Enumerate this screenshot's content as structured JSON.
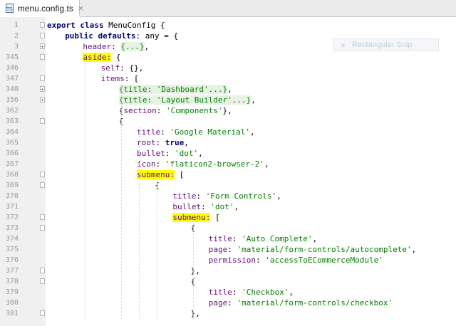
{
  "tab": {
    "file_name": "menu.config.ts",
    "icon": "typescript-file-icon",
    "close": "×",
    "icon_text": "TS"
  },
  "overlay": {
    "label": "Rectangular Snip"
  },
  "lines": [
    {
      "n": "1",
      "fold": "minus",
      "indent": 0,
      "parts": [
        {
          "t": "export class ",
          "c": "kw"
        },
        {
          "t": "MenuConfig {",
          "c": "plain"
        }
      ]
    },
    {
      "n": "2",
      "fold": "minus",
      "indent": 2,
      "parts": [
        {
          "t": "public ",
          "c": "kw"
        },
        {
          "t": "defaults",
          "c": "kw"
        },
        {
          "t": ": any = {",
          "c": "plain"
        }
      ]
    },
    {
      "n": "3",
      "fold": "plus",
      "indent": 4,
      "parts": [
        {
          "t": "header",
          "c": "prop"
        },
        {
          "t": ": ",
          "c": "plain"
        },
        {
          "t": "{...}",
          "c": "folded"
        },
        {
          "t": ",",
          "c": "plain"
        }
      ]
    },
    {
      "n": "345",
      "fold": "minus",
      "indent": 4,
      "parts": [
        {
          "t": "aside:",
          "c": "prop hl"
        },
        {
          "t": " {",
          "c": "plain"
        }
      ]
    },
    {
      "n": "346",
      "fold": "",
      "indent": 6,
      "parts": [
        {
          "t": "self",
          "c": "prop"
        },
        {
          "t": ": {},",
          "c": "plain"
        }
      ]
    },
    {
      "n": "347",
      "fold": "minus",
      "indent": 6,
      "parts": [
        {
          "t": "items",
          "c": "prop"
        },
        {
          "t": ": [",
          "c": "plain"
        }
      ]
    },
    {
      "n": "348",
      "fold": "plus",
      "indent": 8,
      "parts": [
        {
          "t": "{title: 'Dashboard'...}",
          "c": "folded"
        },
        {
          "t": ",",
          "c": "plain"
        }
      ]
    },
    {
      "n": "356",
      "fold": "plus",
      "indent": 8,
      "parts": [
        {
          "t": "{title: 'Layout Builder'...}",
          "c": "folded"
        },
        {
          "t": ",",
          "c": "plain"
        }
      ]
    },
    {
      "n": "362",
      "fold": "",
      "indent": 8,
      "parts": [
        {
          "t": "{",
          "c": "plain"
        },
        {
          "t": "section",
          "c": "prop"
        },
        {
          "t": ": ",
          "c": "plain"
        },
        {
          "t": "'Components'",
          "c": "str"
        },
        {
          "t": "},",
          "c": "plain"
        }
      ]
    },
    {
      "n": "363",
      "fold": "minus",
      "indent": 8,
      "parts": [
        {
          "t": "{",
          "c": "plain"
        }
      ]
    },
    {
      "n": "364",
      "fold": "",
      "indent": 10,
      "parts": [
        {
          "t": "title",
          "c": "prop"
        },
        {
          "t": ": ",
          "c": "plain"
        },
        {
          "t": "'Google Material'",
          "c": "str"
        },
        {
          "t": ",",
          "c": "plain"
        }
      ]
    },
    {
      "n": "365",
      "fold": "",
      "indent": 10,
      "parts": [
        {
          "t": "root",
          "c": "prop"
        },
        {
          "t": ": ",
          "c": "plain"
        },
        {
          "t": "true",
          "c": "kw"
        },
        {
          "t": ",",
          "c": "plain"
        }
      ]
    },
    {
      "n": "366",
      "fold": "",
      "indent": 10,
      "parts": [
        {
          "t": "bullet",
          "c": "prop"
        },
        {
          "t": ": ",
          "c": "plain"
        },
        {
          "t": "'dot'",
          "c": "str"
        },
        {
          "t": ",",
          "c": "plain"
        }
      ]
    },
    {
      "n": "367",
      "fold": "",
      "indent": 10,
      "parts": [
        {
          "t": "icon",
          "c": "prop"
        },
        {
          "t": ": ",
          "c": "plain"
        },
        {
          "t": "'flaticon2-browser-2'",
          "c": "str"
        },
        {
          "t": ",",
          "c": "plain"
        }
      ]
    },
    {
      "n": "368",
      "fold": "minus",
      "indent": 10,
      "parts": [
        {
          "t": "submenu:",
          "c": "prop hl"
        },
        {
          "t": " [",
          "c": "plain"
        }
      ]
    },
    {
      "n": "369",
      "fold": "minus",
      "indent": 12,
      "parts": [
        {
          "t": "{",
          "c": "plain"
        }
      ]
    },
    {
      "n": "370",
      "fold": "",
      "indent": 14,
      "parts": [
        {
          "t": "title",
          "c": "prop"
        },
        {
          "t": ": ",
          "c": "plain"
        },
        {
          "t": "'Form Controls'",
          "c": "str"
        },
        {
          "t": ",",
          "c": "plain"
        }
      ]
    },
    {
      "n": "371",
      "fold": "",
      "indent": 14,
      "parts": [
        {
          "t": "bullet",
          "c": "prop"
        },
        {
          "t": ": ",
          "c": "plain"
        },
        {
          "t": "'dot'",
          "c": "str"
        },
        {
          "t": ",",
          "c": "plain"
        }
      ]
    },
    {
      "n": "372",
      "fold": "minus",
      "indent": 14,
      "parts": [
        {
          "t": "submenu:",
          "c": "prop hl"
        },
        {
          "t": " [",
          "c": "plain"
        }
      ]
    },
    {
      "n": "373",
      "fold": "minus",
      "indent": 16,
      "parts": [
        {
          "t": "{",
          "c": "plain"
        }
      ]
    },
    {
      "n": "374",
      "fold": "",
      "indent": 18,
      "parts": [
        {
          "t": "title",
          "c": "prop"
        },
        {
          "t": ": ",
          "c": "plain"
        },
        {
          "t": "'Auto Complete'",
          "c": "str"
        },
        {
          "t": ",",
          "c": "plain"
        }
      ]
    },
    {
      "n": "375",
      "fold": "",
      "indent": 18,
      "parts": [
        {
          "t": "page",
          "c": "prop"
        },
        {
          "t": ": ",
          "c": "plain"
        },
        {
          "t": "'material/form-controls/autocomplete'",
          "c": "str"
        },
        {
          "t": ",",
          "c": "plain"
        }
      ]
    },
    {
      "n": "376",
      "fold": "",
      "indent": 18,
      "parts": [
        {
          "t": "permission",
          "c": "prop"
        },
        {
          "t": ": ",
          "c": "plain"
        },
        {
          "t": "'accessToECommerceModule'",
          "c": "str"
        }
      ]
    },
    {
      "n": "377",
      "fold": "minus",
      "indent": 16,
      "parts": [
        {
          "t": "},",
          "c": "plain"
        }
      ]
    },
    {
      "n": "378",
      "fold": "minus",
      "indent": 16,
      "parts": [
        {
          "t": "{",
          "c": "plain"
        }
      ]
    },
    {
      "n": "379",
      "fold": "",
      "indent": 18,
      "parts": [
        {
          "t": "title",
          "c": "prop"
        },
        {
          "t": ": ",
          "c": "plain"
        },
        {
          "t": "'Checkbox'",
          "c": "str"
        },
        {
          "t": ",",
          "c": "plain"
        }
      ]
    },
    {
      "n": "380",
      "fold": "",
      "indent": 18,
      "parts": [
        {
          "t": "page",
          "c": "prop"
        },
        {
          "t": ": ",
          "c": "plain"
        },
        {
          "t": "'material/form-controls/checkbox'",
          "c": "str"
        }
      ]
    },
    {
      "n": "381",
      "fold": "minus",
      "indent": 16,
      "parts": [
        {
          "t": "},",
          "c": "plain"
        }
      ]
    }
  ]
}
